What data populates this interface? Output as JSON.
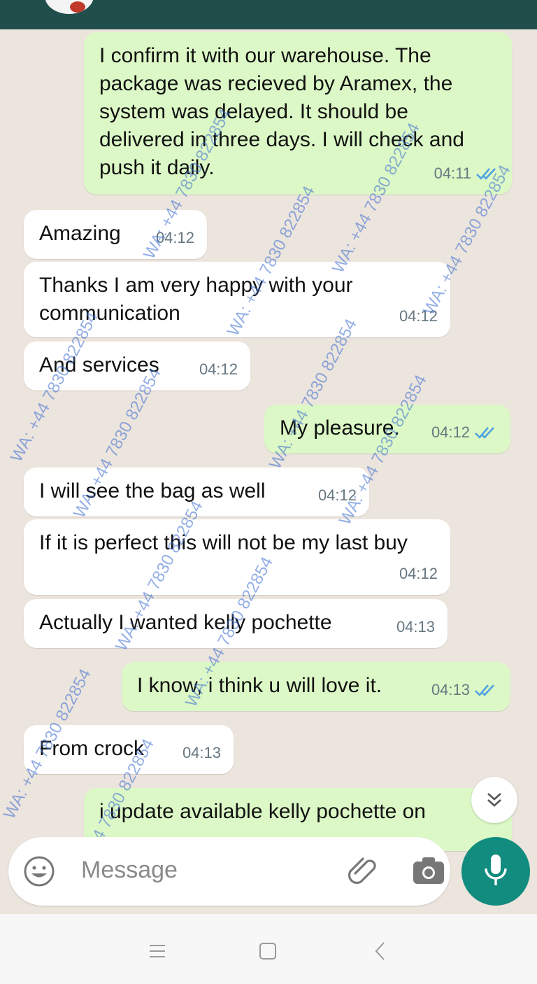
{
  "colors": {
    "header": "#1f4e4b",
    "chat_background": "#ece5dd",
    "incoming_bubble": "#ffffff",
    "outgoing_bubble": "#dcf8c6",
    "read_ticks": "#4fa3e0",
    "mic_button": "#128c7e",
    "watermark": "#3c6ed2"
  },
  "messages": [
    {
      "direction": "out",
      "text": "I confirm it with our warehouse. The package was recieved by Aramex, the system was delayed. It should be delivered in three days. I will check and push it daily.",
      "time": "04:11",
      "status_icon": "double-check-read-icon"
    },
    {
      "direction": "in",
      "text": "Amazing",
      "time": "04:12"
    },
    {
      "direction": "in",
      "text": "Thanks I am very happy with your communication",
      "time": "04:12"
    },
    {
      "direction": "in",
      "text": "And services",
      "time": "04:12"
    },
    {
      "direction": "out",
      "text": "My pleasure.",
      "time": "04:12",
      "status_icon": "double-check-read-icon"
    },
    {
      "direction": "in",
      "text": "I will see the bag as well",
      "time": "04:12"
    },
    {
      "direction": "in",
      "text": "If it is perfect this will not be my last buy",
      "time": "04:12"
    },
    {
      "direction": "in",
      "text": "Actually I wanted kelly pochette",
      "time": "04:13"
    },
    {
      "direction": "out",
      "text": "I know, i think u will love it.",
      "time": "04:13",
      "status_icon": "double-check-read-icon"
    },
    {
      "direction": "in",
      "text": "From crock",
      "time": "04:13"
    },
    {
      "direction": "out",
      "text": "i update available kelly pochette on",
      "time": ""
    }
  ],
  "watermark_text": "WA: +44 7830 822854",
  "composer": {
    "placeholder": "Message",
    "icons": [
      "emoji-icon",
      "attach-icon",
      "camera-icon",
      "mic-icon"
    ]
  },
  "scroll_down_icon": "double-chevron-down-icon",
  "navbar_icons": [
    "menu-icon",
    "home-icon",
    "back-icon"
  ]
}
